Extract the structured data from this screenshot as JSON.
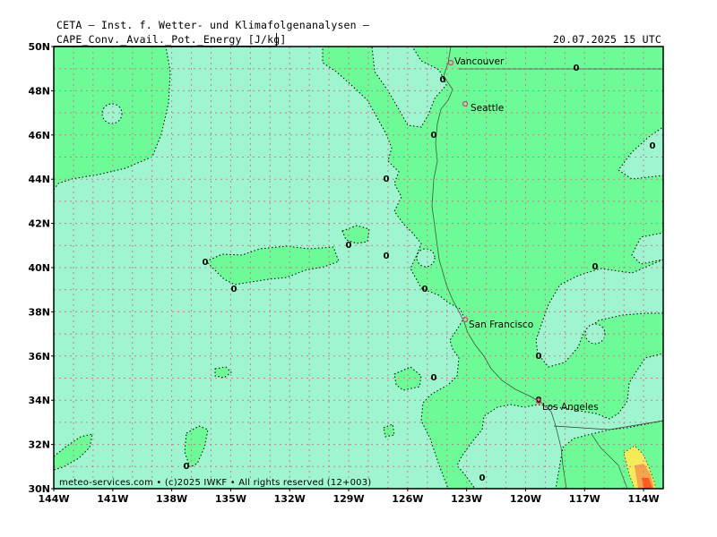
{
  "header": {
    "title": "CETA — Inst. f. Wetter- und Klimafolgenanalysen —",
    "variable": "CAPE_Conv._Avail._Pot._Energy [J/kg]",
    "datetime": "20.07.2025 15 UTC"
  },
  "footer": {
    "copyright": "meteo-services.com • (c)2025 IWKF • All rights reserved (12+003)"
  },
  "axes": {
    "lat_labels": [
      "50N",
      "48N",
      "46N",
      "44N",
      "42N",
      "40N",
      "38N",
      "36N",
      "34N",
      "32N",
      "30N"
    ],
    "lon_labels": [
      "144W",
      "141W",
      "138W",
      "135W",
      "132W",
      "129W",
      "126W",
      "123W",
      "120W",
      "117W",
      "114W"
    ]
  },
  "cities": [
    {
      "name": "Vancouver"
    },
    {
      "name": "Seattle"
    },
    {
      "name": "San Francisco"
    },
    {
      "name": "Los Angeles"
    }
  ],
  "contour_value": "0",
  "colors": {
    "ocean": "#9ef5d0",
    "land_low": "#6cfb96",
    "cape_mid": "#f4ea5a",
    "cape_high": "#f5a44c",
    "cape_max": "#ff5a1e",
    "grid": "#c8808c",
    "city_marker": "#e0407a"
  }
}
